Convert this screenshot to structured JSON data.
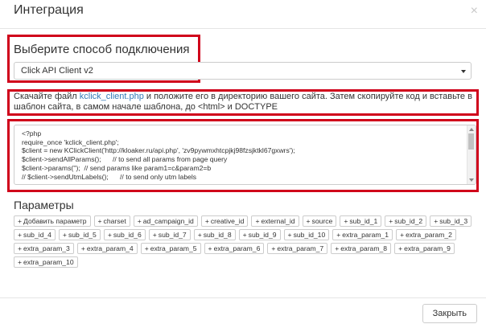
{
  "modal": {
    "title": "Интеграция",
    "close_symbol": "×"
  },
  "connection": {
    "heading": "Выберите способ подключения",
    "selected": "Click API Client v2"
  },
  "instructions": {
    "prefix": "Скачайте файл ",
    "link": "kclick_client.php",
    "suffix": " и положите его в директорию вашего сайта. Затем скопируйте код и вставьте в шаблон сайта, в самом начале шаблона, до <html> и DOCTYPE"
  },
  "code": {
    "lines": [
      "<?php",
      "require_once 'kclick_client.php';",
      "$client = new KClickClient('http://kloaker.ru/api.php', 'zv9pywmxhtcpjkj98fzsjktkl67gxwrs');",
      "$client->sendAllParams();      // to send all params from page query",
      "$client->params('');  // send params like param1=c&param2=b",
      "// $client->sendUtmLabels();      // to send only utm labels"
    ]
  },
  "params": {
    "heading": "Параметры",
    "add_label": "Добавить параметр",
    "items": [
      "charset",
      "ad_campaign_id",
      "creative_id",
      "external_id",
      "source",
      "sub_id_1",
      "sub_id_2",
      "sub_id_3",
      "sub_id_4",
      "sub_id_5",
      "sub_id_6",
      "sub_id_7",
      "sub_id_8",
      "sub_id_9",
      "sub_id_10",
      "extra_param_1",
      "extra_param_2",
      "extra_param_3",
      "extra_param_4",
      "extra_param_5",
      "extra_param_6",
      "extra_param_7",
      "extra_param_8",
      "extra_param_9",
      "extra_param_10"
    ]
  },
  "footer": {
    "close_label": "Закрыть"
  },
  "colors": {
    "highlight": "#d0021b",
    "link": "#337ab7"
  }
}
